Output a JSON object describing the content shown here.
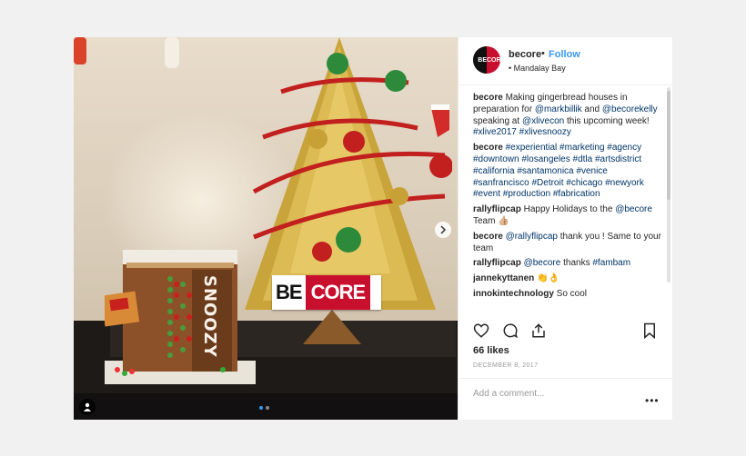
{
  "post": {
    "username": "becore",
    "bullet": "•",
    "follow_label": "Follow",
    "location": "Mandalay Bay",
    "avatar_left": "BE",
    "avatar_right": "CORE",
    "banner_left": "BE",
    "banner_right": "CORE",
    "house_sign": "SNOOZY"
  },
  "comments": [
    {
      "user": "becore",
      "segments": [
        {
          "t": "Making gingerbread houses in preparation for ",
          "link": false
        },
        {
          "t": "@markbillik",
          "link": true
        },
        {
          "t": " and ",
          "link": false
        },
        {
          "t": "@becorekelly",
          "link": true
        },
        {
          "t": " speaking at ",
          "link": false
        },
        {
          "t": "@xlivecon",
          "link": true
        },
        {
          "t": " this upcoming week! ",
          "link": false
        },
        {
          "t": "#xlive2017",
          "link": true
        },
        {
          "t": " ",
          "link": false
        },
        {
          "t": "#xlivesnoozy",
          "link": true
        }
      ]
    },
    {
      "user": "becore",
      "segments": [
        {
          "t": "#experiential #marketing #agency #downtown #losangeles #dtla #artsdistrict #california #santamonica #venice #sanfrancisco #Detroit #chicago #newyork #event #production #fabrication",
          "link": true
        }
      ]
    },
    {
      "user": "rallyflipcap",
      "segments": [
        {
          "t": "Happy Holidays to the ",
          "link": false
        },
        {
          "t": "@becore",
          "link": true
        },
        {
          "t": " Team 👍🏼",
          "link": false
        }
      ]
    },
    {
      "user": "becore",
      "segments": [
        {
          "t": "@rallyflipcap",
          "link": true
        },
        {
          "t": " thank you ! Same to your team",
          "link": false
        }
      ]
    },
    {
      "user": "rallyflipcap",
      "segments": [
        {
          "t": "@becore",
          "link": true
        },
        {
          "t": " thanks ",
          "link": false
        },
        {
          "t": "#fambam",
          "link": true
        }
      ]
    },
    {
      "user": "jannekyttanen",
      "segments": [
        {
          "t": "👏👌",
          "link": false
        }
      ]
    },
    {
      "user": "innokintechnology",
      "segments": [
        {
          "t": "So cool",
          "link": false
        }
      ]
    }
  ],
  "stats": {
    "likes": "66 likes",
    "date": "DECEMBER 8, 2017"
  },
  "add_comment": {
    "placeholder": "Add a comment...",
    "more": "•••"
  },
  "icons": {
    "like": "heart-icon",
    "comment": "comment-icon",
    "share": "share-icon",
    "save": "bookmark-icon",
    "next": "chevron-right-icon",
    "tag": "user-tag-icon"
  },
  "colors": {
    "brand_red": "#c8102e",
    "link_blue": "#003569",
    "follow_blue": "#3897f0"
  }
}
